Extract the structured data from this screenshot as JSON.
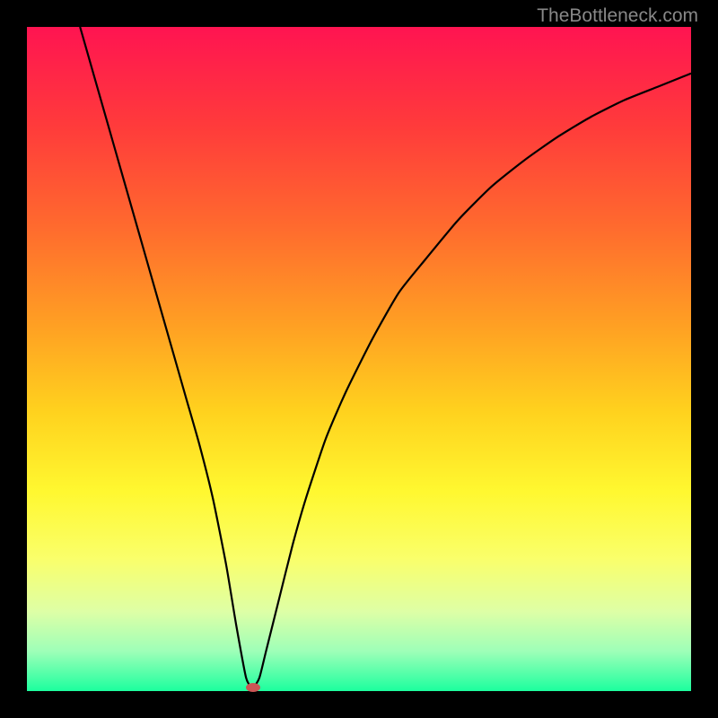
{
  "watermark": "TheBottleneck.com",
  "chart_data": {
    "type": "line",
    "title": "",
    "xlabel": "",
    "ylabel": "",
    "xlim": [
      0,
      100
    ],
    "ylim": [
      0,
      100
    ],
    "gradient_stops": [
      {
        "offset": 0,
        "color": "#ff1451"
      },
      {
        "offset": 15,
        "color": "#ff3b3b"
      },
      {
        "offset": 30,
        "color": "#ff6a2e"
      },
      {
        "offset": 45,
        "color": "#ffa023"
      },
      {
        "offset": 58,
        "color": "#ffd21e"
      },
      {
        "offset": 70,
        "color": "#fff830"
      },
      {
        "offset": 80,
        "color": "#faff6a"
      },
      {
        "offset": 88,
        "color": "#deffa6"
      },
      {
        "offset": 94,
        "color": "#9effb8"
      },
      {
        "offset": 100,
        "color": "#1cff9e"
      }
    ],
    "series": [
      {
        "name": "bottleneck-curve",
        "x": [
          8,
          10,
          12,
          14,
          16,
          18,
          20,
          22,
          24,
          26,
          28,
          30,
          31.5,
          33,
          34,
          35,
          36,
          38,
          40,
          42,
          45,
          48,
          52,
          56,
          60,
          65,
          70,
          75,
          80,
          85,
          90,
          95,
          100
        ],
        "values": [
          100,
          93,
          86,
          79,
          72,
          65,
          58,
          51,
          44,
          37,
          29,
          19,
          10,
          2,
          0.5,
          2,
          6,
          14,
          22,
          29,
          38,
          45,
          53,
          60,
          65,
          71,
          76,
          80,
          83.5,
          86.5,
          89,
          91,
          93
        ]
      }
    ],
    "marker": {
      "x": 34,
      "y": 0.5,
      "color": "#cc5555"
    }
  }
}
